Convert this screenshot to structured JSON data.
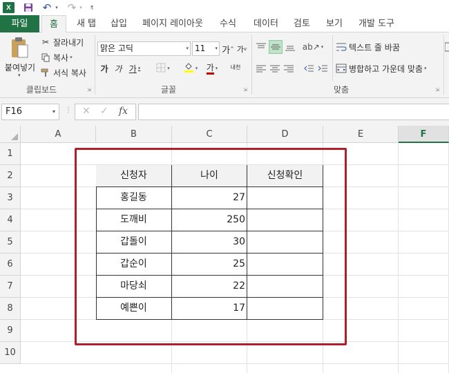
{
  "app": {
    "logo_letter": "X"
  },
  "tabs": {
    "file": "파일",
    "home": "홈",
    "newtab": "새 탭",
    "insert": "삽입",
    "pagelayout": "페이지 레이아웃",
    "formulas": "수식",
    "data": "데이터",
    "review": "검토",
    "view": "보기",
    "developer": "개발 도구"
  },
  "ribbon": {
    "clipboard": {
      "paste": "붙여넣기",
      "cut": "잘라내기",
      "copy": "복사",
      "format_painter": "서식 복사",
      "label": "클립보드"
    },
    "font": {
      "name": "맑은 고딕",
      "size": "11",
      "grow": "가",
      "shrink": "가",
      "bold": "가",
      "italic": "가",
      "underline": "가",
      "font_color": "가",
      "phonetic": "내천",
      "label": "글꼴"
    },
    "alignment": {
      "wrap_text": "텍스트 줄 바꿈",
      "merge_center": "병합하고 가운데 맞춤",
      "label": "맞춤"
    }
  },
  "formula_bar": {
    "name_box": "F16",
    "fx": "fx",
    "formula": ""
  },
  "sheet": {
    "columns": [
      "A",
      "B",
      "C",
      "D",
      "E",
      "F"
    ],
    "rows": [
      "1",
      "2",
      "3",
      "4",
      "5",
      "6",
      "7",
      "8",
      "9",
      "10"
    ],
    "table": {
      "headers": [
        "신청자",
        "나이",
        "신청확인"
      ],
      "rows": [
        {
          "name": "홍길동",
          "age": "27",
          "confirm": ""
        },
        {
          "name": "도깨비",
          "age": "250",
          "confirm": ""
        },
        {
          "name": "갑돌이",
          "age": "30",
          "confirm": ""
        },
        {
          "name": "갑순이",
          "age": "25",
          "confirm": ""
        },
        {
          "name": "마당쇠",
          "age": "22",
          "confirm": ""
        },
        {
          "name": "예쁜이",
          "age": "17",
          "confirm": ""
        }
      ]
    }
  },
  "colors": {
    "brand": "#217346",
    "highlight": "#b01e2a"
  }
}
